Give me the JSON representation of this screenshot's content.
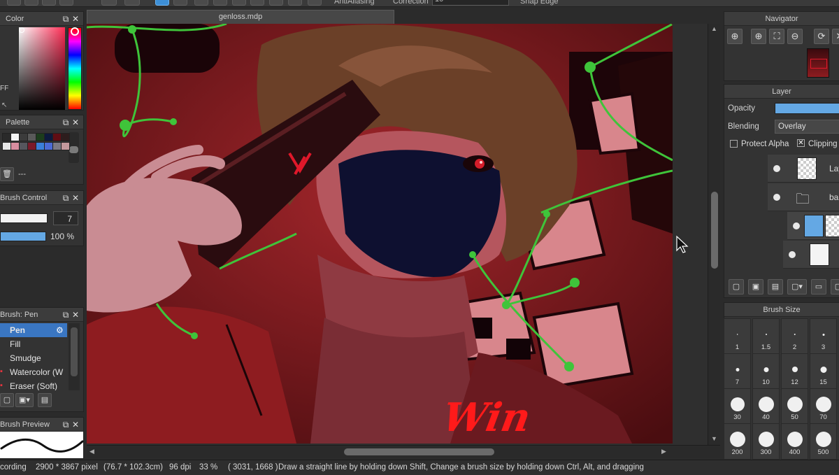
{
  "toolbar": {
    "antialiasing_label": "AntiAliasing",
    "correction_label": "Correction",
    "correction_value": "10",
    "snap_edge_label": "Snap Edge"
  },
  "document": {
    "tab_title": "genloss.mdp"
  },
  "color_panel": {
    "title": "Color",
    "hex_fragment": "FF"
  },
  "palette_panel": {
    "title": "Palette",
    "add_label": "---",
    "swatches": [
      "#2a2a2a",
      "#f5f5f5",
      "#3b3b3b",
      "#595959",
      "#1c3d1c",
      "#0d1a3d",
      "#600d14",
      "#2d1d1d",
      "#e6e6e6",
      "#d88da0",
      "#55565d",
      "#7b1a2a",
      "#3b7fd9",
      "#4c6ad5",
      "#7d7a84",
      "#c4989c"
    ]
  },
  "brush_control": {
    "title": "Brush Control",
    "size_value": "7",
    "opacity_value": "100 %"
  },
  "brush_panel": {
    "title": "Brush: Pen",
    "items": [
      "Pen",
      "Fill",
      "Smudge",
      "Watercolor (W",
      "Eraser (Soft)"
    ],
    "selected_index": 0
  },
  "brush_preview": {
    "title": "Brush Preview"
  },
  "navigator": {
    "title": "Navigator"
  },
  "layer_panel": {
    "title": "Layer",
    "opacity_label": "Opacity",
    "opacity_value": 1.0,
    "blending_label": "Blending",
    "blending_value": "Overlay",
    "protect_alpha_label": "Protect Alpha",
    "protect_alpha_checked": false,
    "clipping_label": "Clipping",
    "clipping_checked": true,
    "layers": [
      {
        "name": "Lay",
        "type": "layer"
      },
      {
        "name": "ba",
        "type": "folder"
      },
      {
        "name": "",
        "type": "layer-selected"
      },
      {
        "name": "",
        "type": "layer-art"
      }
    ]
  },
  "brush_size_panel": {
    "title": "Brush Size",
    "sizes": [
      "1",
      "1.5",
      "2",
      "3",
      "7",
      "10",
      "12",
      "15",
      "30",
      "40",
      "50",
      "70",
      "200",
      "300",
      "400",
      "500"
    ]
  },
  "artwork": {
    "signature_text": "Win",
    "bg_color": "#7a1a1e",
    "accent_green": "#3fc43a"
  },
  "status": {
    "recording": "cording",
    "dimensions": "2900 * 3867 pixel",
    "physical": "(76.7 * 102.3cm)",
    "dpi": "96 dpi",
    "zoom": "33 %",
    "cursor": "( 3031, 1668 )",
    "hint": "Draw a straight line by holding down Shift, Change a brush size by holding down Ctrl, Alt, and dragging"
  }
}
